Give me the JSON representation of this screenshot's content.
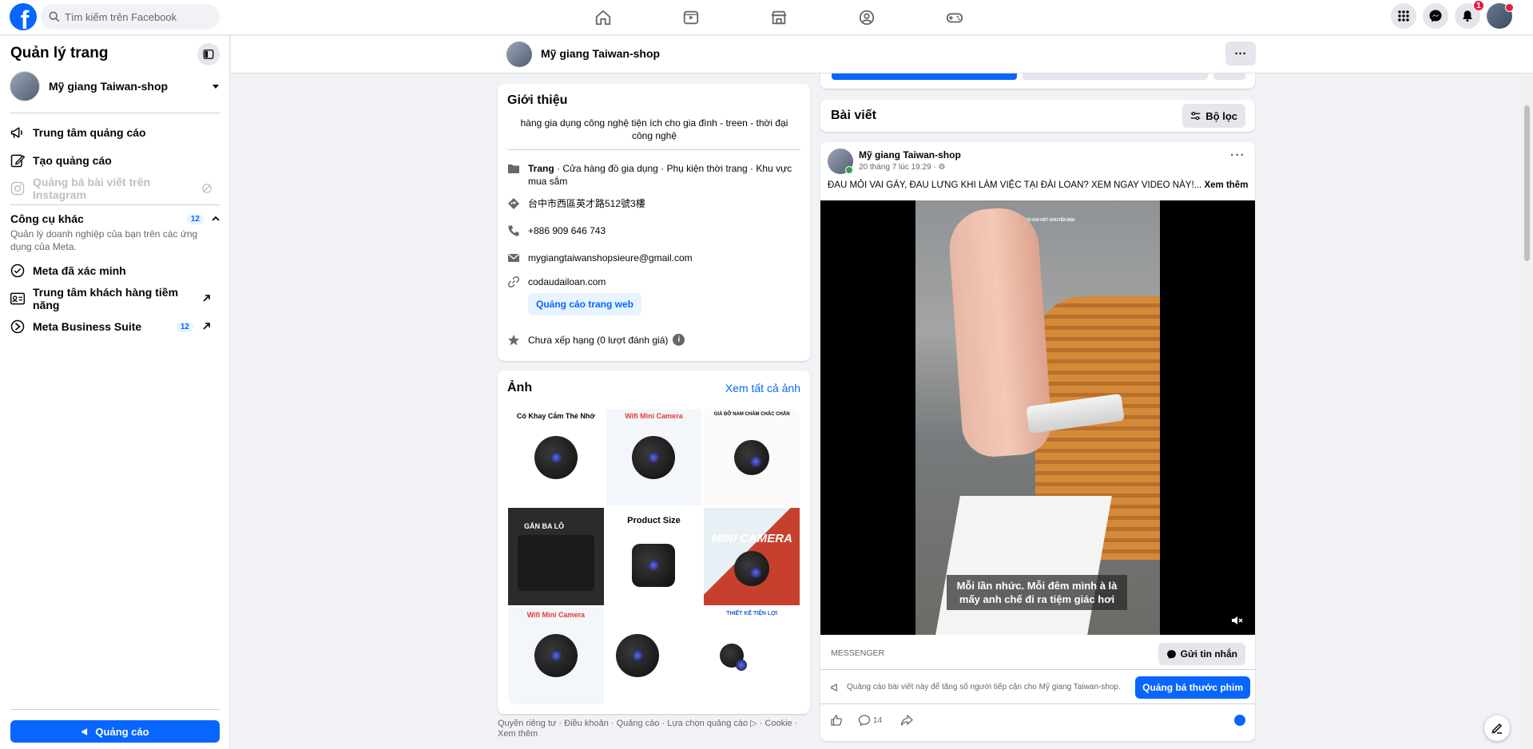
{
  "topbar": {
    "logo": "f",
    "search_placeholder": "Tìm kiếm trên Facebook",
    "nav_icons": [
      "home-icon",
      "video-icon",
      "marketplace-icon",
      "groups-icon",
      "gaming-icon"
    ],
    "notification_count": "1"
  },
  "sidebar": {
    "title": "Quản lý trang",
    "page_name": "Mỹ giang Taiwan-shop",
    "items": [
      {
        "label": "Trung tâm quảng cáo",
        "icon": "megaphone-icon"
      },
      {
        "label": "Tạo quảng cáo",
        "icon": "edit-icon"
      },
      {
        "label": "Quảng bá bài viết trên Instagram",
        "icon": "instagram-icon"
      }
    ],
    "other_tools": {
      "title": "Công cụ khác",
      "count": "12",
      "description": "Quản lý doanh nghiệp của bạn trên các ứng dụng của Meta."
    },
    "tools": [
      {
        "label": "Meta đã xác minh",
        "icon": "verified-icon"
      },
      {
        "label": "Trung tâm khách hàng tiềm năng",
        "icon": "leads-icon"
      },
      {
        "label": "Meta Business Suite",
        "icon": "meta-business-icon",
        "count": "12"
      }
    ],
    "ad_button": "Quảng cáo"
  },
  "page_header": {
    "name": "Mỹ giang Taiwan-shop",
    "more": "···"
  },
  "intro": {
    "title": "Giới thiệu",
    "bio": "hàng gia dụng công nghệ tiện ích cho gia đình - treen - thời đại công nghệ",
    "category_prefix": "Trang",
    "category": " · Cửa hàng đồ gia dụng · Phụ kiện thời trang · Khu vực mua sắm",
    "address": "台中市西區英才路512號3樓",
    "phone": "+886 909 646 743",
    "email": "mygiangtaiwanshopsieure@gmail.com",
    "website": "codaudailoan.com",
    "web_ad_button": "Quảng cáo trang web",
    "rating": "Chưa xếp hạng (0 lượt đánh giá)",
    "rating_info": "i"
  },
  "photos": {
    "title": "Ảnh",
    "see_all": "Xem tất cả ảnh",
    "captions": [
      "Có Khay Cắm Thẻ Nhớ",
      "Wifi Mini Camera",
      "GIÁ ĐỠ NAM CHÂM CHẮC CHẮN",
      "GẮN BA LÔ",
      "Product Size",
      "MINI CAMERA",
      "Wifi Mini Camera",
      "",
      "THIẾT KẾ TIỆN LỢI"
    ]
  },
  "footer": {
    "text": "Quyền riêng tư · Điều khoản · Quảng cáo · Lựa chọn quảng cáo ▷ · Cookie · Xem thêm"
  },
  "posts": {
    "title": "Bài viết",
    "filter": "Bộ lọc"
  },
  "post": {
    "author": "Mỹ giang Taiwan-shop",
    "time": "20 tháng 7 lúc 19:29 · ⚙",
    "text": "ĐAU MỎI VAI GÁY, ĐAU LƯNG KHI LÀM VIỆC TẠI ĐÀI LOAN? XEM NGAY VIDEO NÀY!...",
    "see_more": "Xem thêm",
    "subtitle": "Mỗi lần nhức. Mỗi đêm mình à là mấy anh chế đi ra tiệm giác hơi",
    "video_overlay": "GIÁ CÓ THỂ THAY ĐỔI KHI HẾT KHUYẾN MẠI",
    "messenger_label": "MESSENGER",
    "send_message": "Gửi tin nhắn",
    "boost_text": "Quảng cáo bài viết này để tăng số người tiếp cận cho Mỹ giang Taiwan-shop.",
    "boost_button": "Quảng bá thước phim",
    "comment_count": "14"
  },
  "colors": {
    "brand": "#0866ff",
    "background": "#f0f2f5",
    "badge": "#e41e3f"
  }
}
